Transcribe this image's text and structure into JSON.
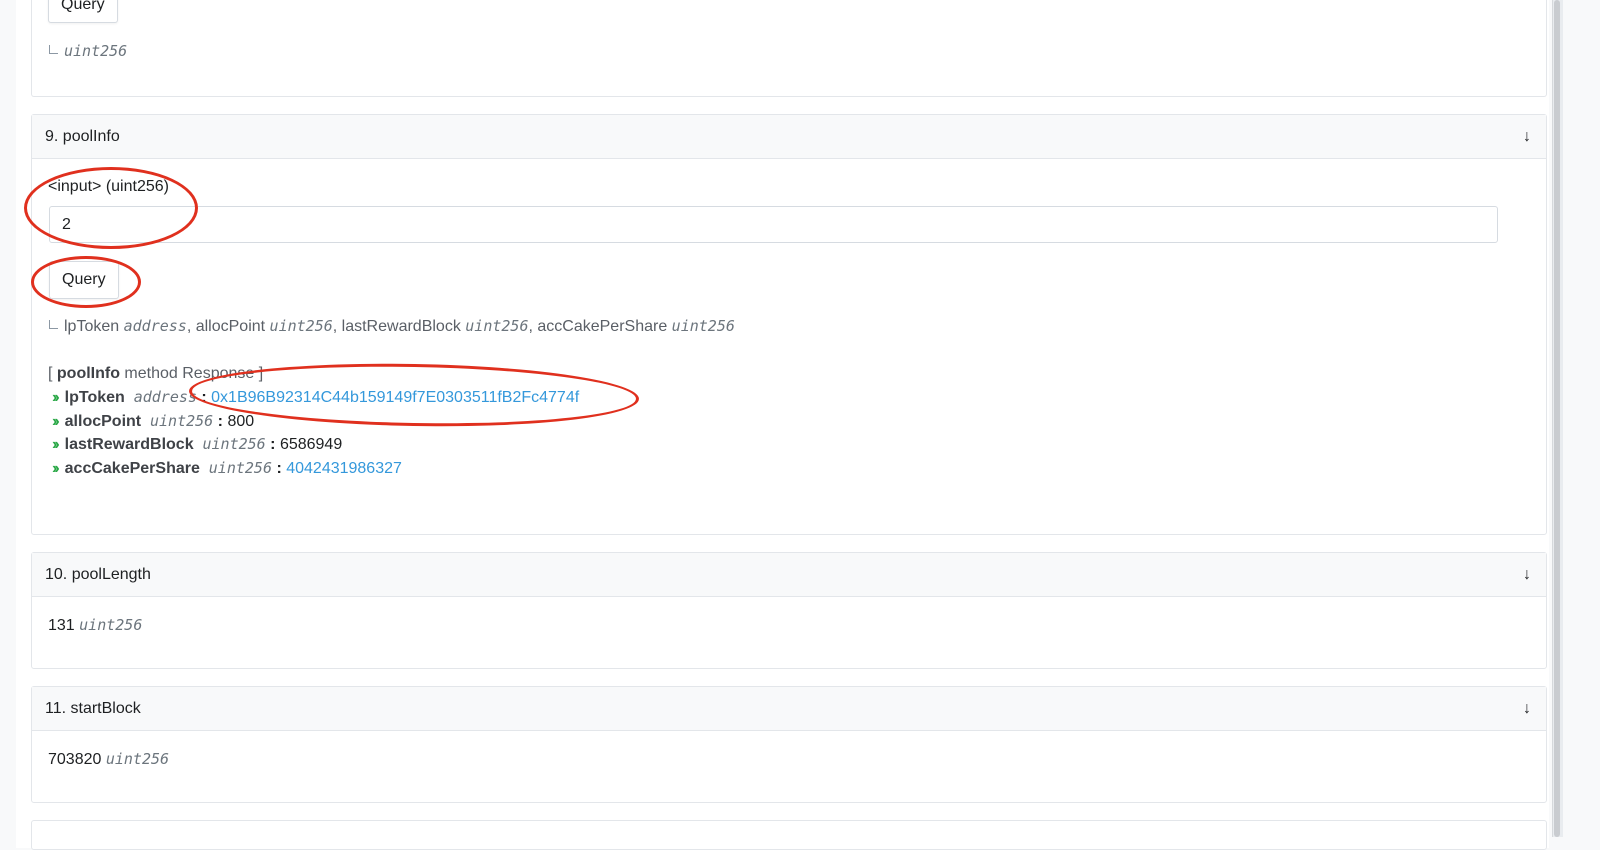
{
  "colors": {
    "accent_link": "#3498db",
    "chevron_green": "#28a745",
    "annotation_red": "#e0301e"
  },
  "top_section": {
    "query_label": "Query",
    "return_type": "uint256"
  },
  "pool_info": {
    "header": "9. poolInfo",
    "toggle_icon": "arrow-down-icon",
    "input_label": "<input> (uint256)",
    "input_value": "2",
    "query_label": "Query",
    "outputs": [
      {
        "name": "lpToken",
        "type": "address",
        "sep": ", "
      },
      {
        "name": "allocPoint",
        "type": "uint256",
        "sep": ", "
      },
      {
        "name": "lastRewardBlock",
        "type": "uint256",
        "sep": ", "
      },
      {
        "name": "accCakePerShare",
        "type": "uint256",
        "sep": ""
      }
    ],
    "response_prefix": "[ ",
    "response_method": "poolInfo",
    "response_suffix": " method Response ]",
    "response": [
      {
        "name": "lpToken",
        "type": "address",
        "value": "0x1B96B92314C44b159149f7E0303511fB2Fc4774f",
        "is_link": true
      },
      {
        "name": "allocPoint",
        "type": "uint256",
        "value": "800",
        "is_link": false
      },
      {
        "name": "lastRewardBlock",
        "type": "uint256",
        "value": "6586949",
        "is_link": false
      },
      {
        "name": "accCakePerShare",
        "type": "uint256",
        "value": "4042431986327",
        "is_link": true
      }
    ]
  },
  "pool_length": {
    "header": "10. poolLength",
    "value": "131",
    "type": "uint256"
  },
  "start_block": {
    "header": "11. startBlock",
    "value": "703820",
    "type": "uint256"
  }
}
